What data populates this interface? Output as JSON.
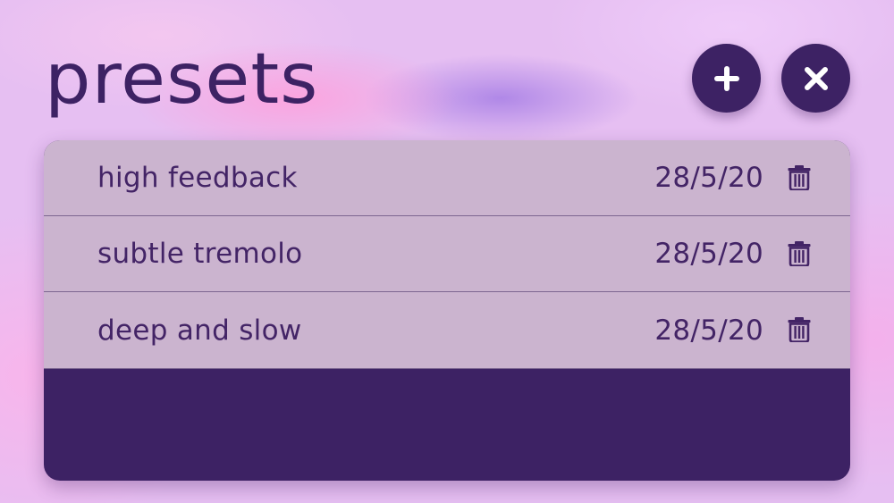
{
  "header": {
    "title": "presets",
    "add_icon": "plus-icon",
    "close_icon": "close-icon"
  },
  "presets": [
    {
      "name": "high feedback",
      "date": "28/5/20",
      "icon": "trash-icon"
    },
    {
      "name": "subtle tremolo",
      "date": "28/5/20",
      "icon": "trash-icon"
    },
    {
      "name": "deep and slow",
      "date": "28/5/20",
      "icon": "trash-icon"
    }
  ],
  "colors": {
    "accent": "#3d2264",
    "row_bg": "#cbb4cf",
    "text": "#432466"
  }
}
